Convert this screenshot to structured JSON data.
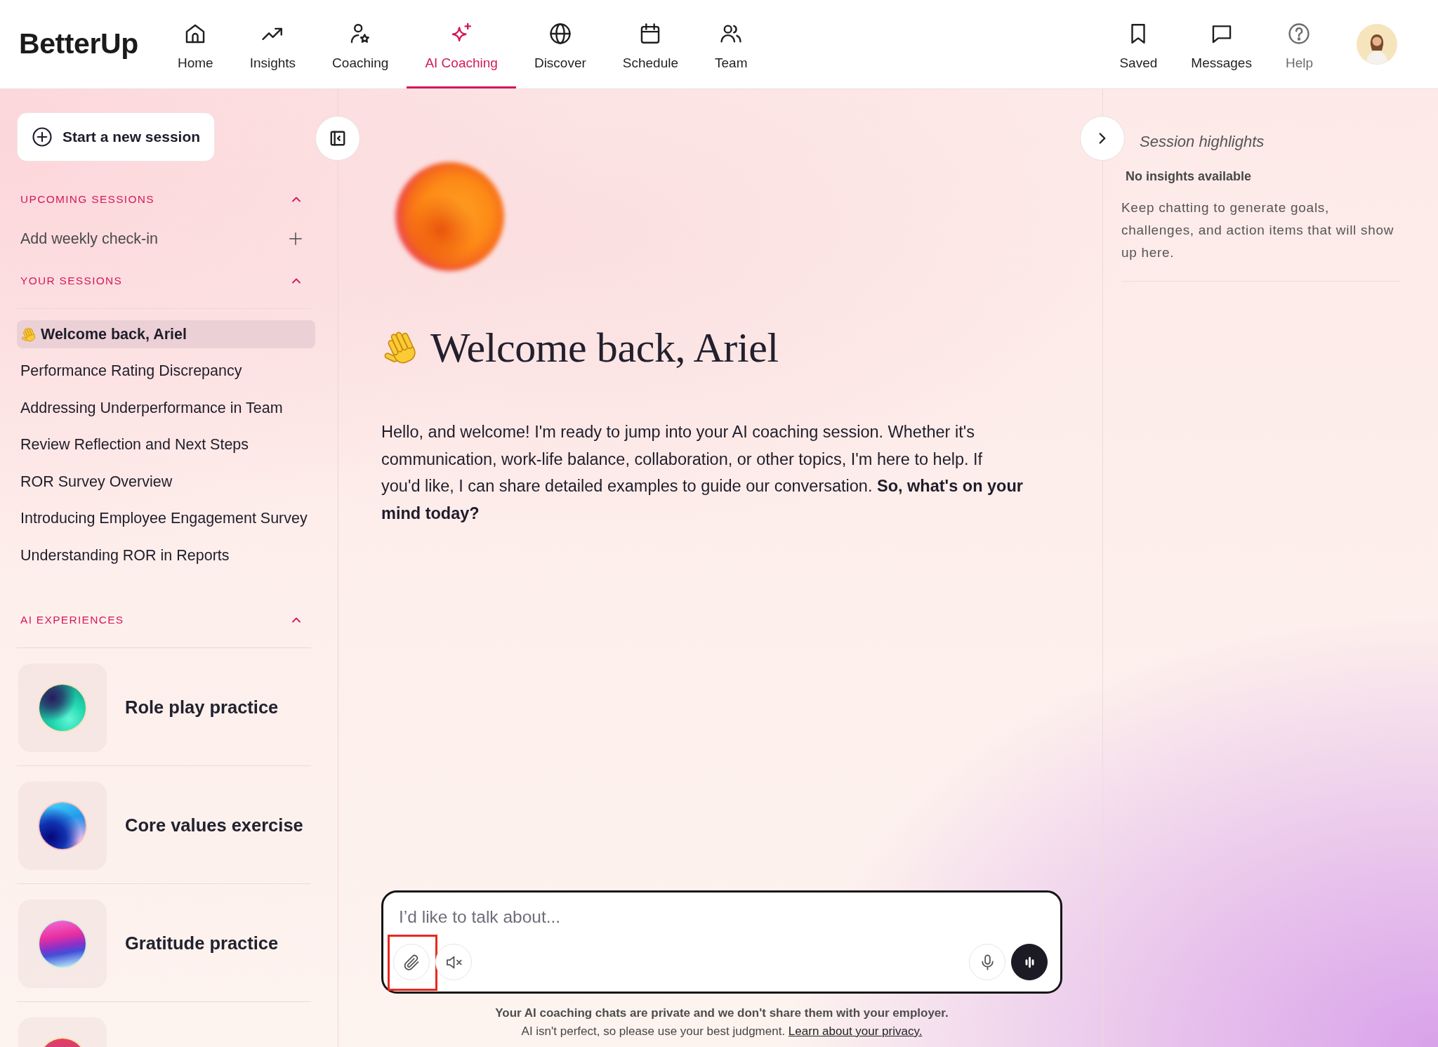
{
  "nav": {
    "logo": "BetterUp",
    "items": [
      {
        "label": "Home",
        "selected": false
      },
      {
        "label": "Insights",
        "selected": false
      },
      {
        "label": "Coaching",
        "selected": false
      },
      {
        "label": "AI Coaching",
        "selected": true
      },
      {
        "label": "Discover",
        "selected": false
      },
      {
        "label": "Schedule",
        "selected": false
      },
      {
        "label": "Team",
        "selected": false
      }
    ],
    "right_items": [
      {
        "label": "Saved",
        "muted": false
      },
      {
        "label": "Messages",
        "muted": false
      },
      {
        "label": "Help",
        "muted": true
      }
    ]
  },
  "sidebar": {
    "new_session": "Start a new session",
    "sections": [
      {
        "title": "UPCOMING SESSIONS",
        "expanded": true,
        "items": [
          {
            "kind": "add",
            "label": "Add weekly check-in"
          }
        ]
      },
      {
        "title": "YOUR SESSIONS",
        "expanded": true,
        "items": [
          {
            "kind": "greeting",
            "label": "Welcome back, Ariel",
            "selected": true
          },
          {
            "kind": "session",
            "label": "Performance Rating Discrepancy",
            "selected": false
          },
          {
            "kind": "session",
            "label": "Addressing Underperformance in Team",
            "selected": false
          },
          {
            "kind": "session",
            "label": "Review Reflection and Next Steps",
            "selected": false
          },
          {
            "kind": "session",
            "label": "ROR Survey Overview",
            "selected": false
          },
          {
            "kind": "session",
            "label": "Introducing Employee Engagement Survey",
            "selected": false
          },
          {
            "kind": "session",
            "label": "Understanding ROR in Reports",
            "selected": false
          }
        ]
      },
      {
        "title": "AI EXPERIENCES",
        "expanded": true,
        "items": [
          {
            "kind": "experience",
            "title": "Role play practice"
          },
          {
            "kind": "experience",
            "title": "Core values exercise"
          },
          {
            "kind": "experience",
            "title": "Gratitude practice"
          },
          {
            "kind": "experience_cut_off"
          }
        ]
      }
    ]
  },
  "main": {
    "greeting": "Welcome back, Ariel",
    "message": "Hello, and welcome! I'm ready to jump into your AI coaching session. Whether it's communication, work-life balance, collaboration, or other topics, I'm here to help. If you'd like, I can share detailed examples to guide our conversation. **So, what's on your mind today?**",
    "composer": {
      "placeholder": "I’d like to talk about...",
      "tools": [
        {
          "kind": "attach",
          "highlighted": true
        },
        {
          "kind": "mute",
          "highlighted": false
        },
        {
          "kind": "mic",
          "highlighted": false
        },
        {
          "kind": "voice",
          "highlighted": false
        }
      ]
    },
    "disclaimer": {
      "notice": "Your AI coaching chats are private and we don't share them with your employer.",
      "note": "AI isn't perfect, so please use your best judgment.",
      "link": "Learn about your privacy."
    }
  },
  "highlights": {
    "title": "Session highlights",
    "empty_title": "No insights available",
    "empty_text": "Keep chatting to generate goals, challenges, and action items that will show up here."
  }
}
